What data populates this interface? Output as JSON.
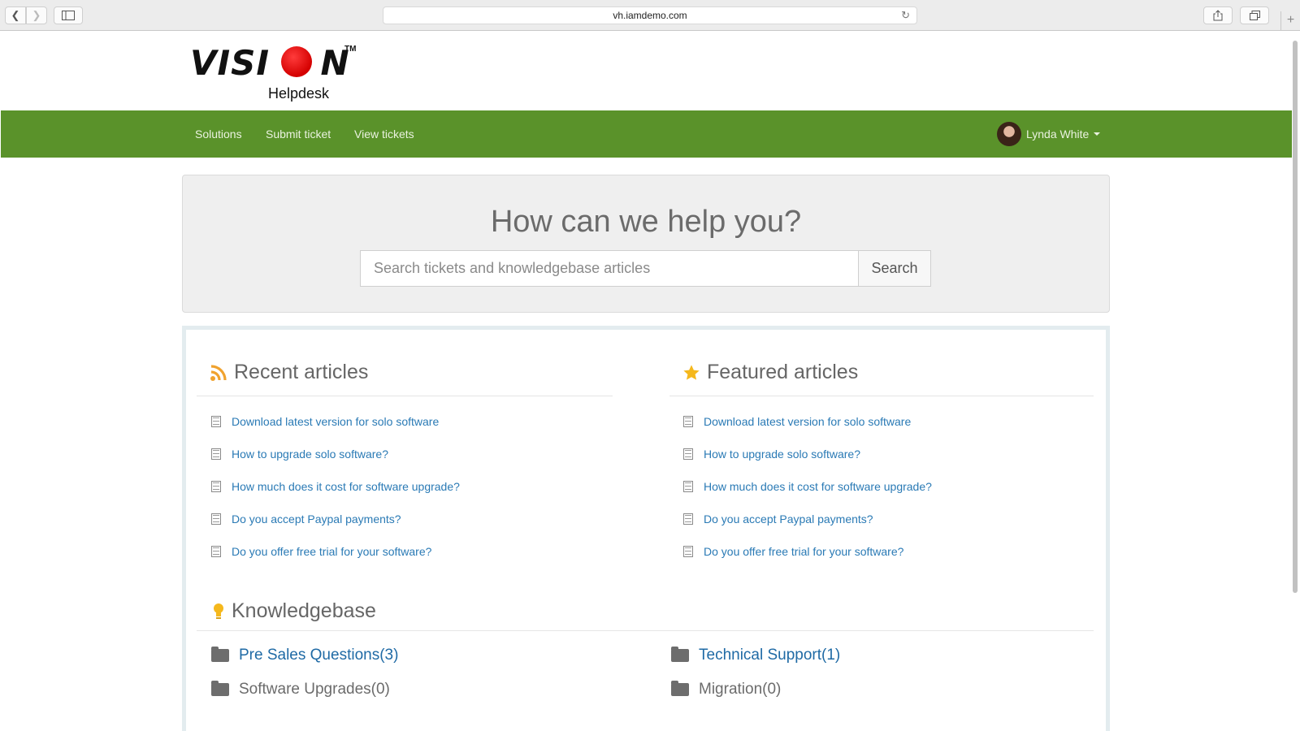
{
  "browser": {
    "url": "vh.iamdemo.com"
  },
  "brand": {
    "name": "VISION",
    "trademark": "TM",
    "subtitle": "Helpdesk"
  },
  "nav": {
    "links": [
      "Solutions",
      "Submit ticket",
      "View tickets"
    ],
    "user_name": "Lynda White"
  },
  "hero": {
    "title": "How can we help you?",
    "search_placeholder": "Search tickets and knowledgebase articles",
    "search_button": "Search"
  },
  "recent": {
    "title": "Recent articles",
    "items": [
      "Download latest version for solo software",
      "How to upgrade solo software?",
      "How much does it cost for software upgrade?",
      "Do you accept Paypal payments?",
      "Do you offer free trial for your software?"
    ]
  },
  "featured": {
    "title": "Featured articles",
    "items": [
      "Download latest version for solo software",
      "How to upgrade solo software?",
      "How much does it cost for software upgrade?",
      "Do you accept Paypal payments?",
      "Do you offer free trial for your software?"
    ]
  },
  "knowledgebase": {
    "title": "Knowledgebase",
    "categories": [
      {
        "label": "Pre Sales Questions(3)",
        "color": "#1f6aa5"
      },
      {
        "label": "Technical Support(1)",
        "color": "#1f6aa5"
      },
      {
        "label": "Software Upgrades(0)",
        "color": "#6b6b6b"
      },
      {
        "label": "Migration(0)",
        "color": "#6b6b6b"
      }
    ]
  },
  "colors": {
    "navbar": "#5a922a",
    "link": "#2a7ab5",
    "rss": "#f0a22e",
    "star": "#f5b81c"
  }
}
